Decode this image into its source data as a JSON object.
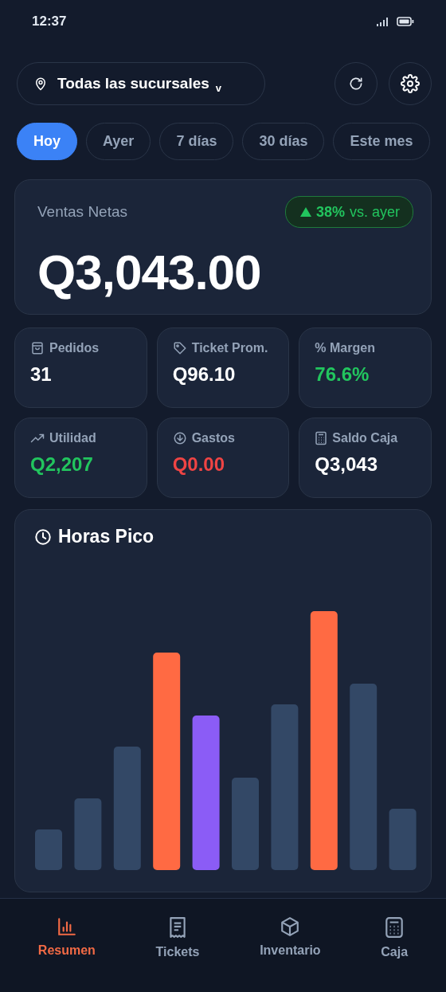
{
  "status_bar": {
    "time": "12:37"
  },
  "branch_selector": {
    "label": "Todas las sucursales",
    "caret": "v"
  },
  "periods": [
    {
      "label": "Hoy",
      "selected": true
    },
    {
      "label": "Ayer",
      "selected": false
    },
    {
      "label": "7 días",
      "selected": false
    },
    {
      "label": "30 días",
      "selected": false
    },
    {
      "label": "Este mes",
      "selected": false
    }
  ],
  "net_sales": {
    "label": "Ventas Netas",
    "change": "38%",
    "change_suffix": "vs. ayer",
    "value": "Q3,043.00"
  },
  "metrics": [
    {
      "label": "Pedidos",
      "value": "31",
      "color": "#ffffff"
    },
    {
      "label": "Ticket Prom.",
      "value": "Q96.10",
      "color": "#ffffff"
    },
    {
      "label": "% Margen",
      "value": "76.6%",
      "color": "#22c55e"
    },
    {
      "label": "Utilidad",
      "value": "Q2,207",
      "color": "#22c55e"
    },
    {
      "label": "Gastos",
      "value": "Q0.00",
      "color": "#ef4444"
    },
    {
      "label": "Saldo Caja",
      "value": "Q3,043",
      "color": "#ffffff"
    }
  ],
  "peak_hours": {
    "title": "Horas Pico"
  },
  "bottom_nav": [
    {
      "label": "Resumen",
      "selected": true
    },
    {
      "label": "Tickets",
      "selected": false
    },
    {
      "label": "Inventario",
      "selected": false
    },
    {
      "label": "Caja",
      "selected": false
    }
  ]
}
